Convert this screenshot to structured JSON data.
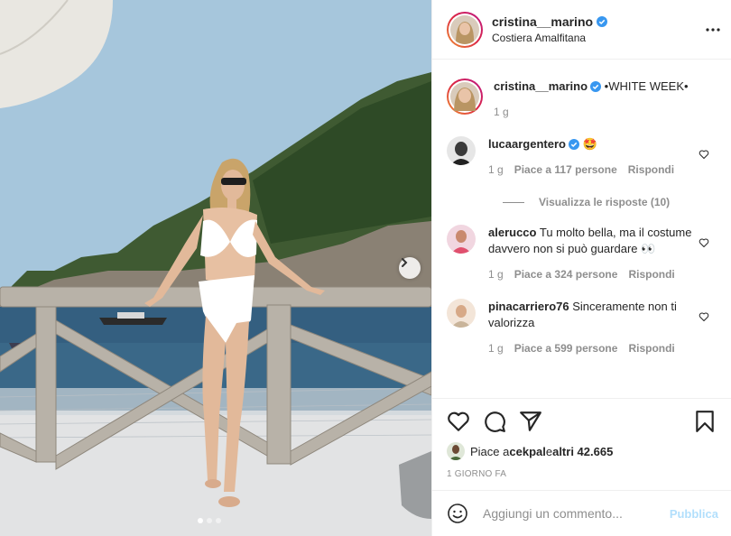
{
  "post": {
    "username": "cristina__marino",
    "location": "Costiera Amalfitana",
    "more_icon": "more-horizontal-icon"
  },
  "caption": {
    "username": "cristina__marino",
    "text": "•WHITE WEEK•",
    "time": "1 g"
  },
  "comments": [
    {
      "username": "lucaargentero",
      "verified": true,
      "text": "🤩",
      "time": "1 g",
      "likes": "Piace a 117 persone",
      "reply": "Rispondi"
    },
    {
      "username": "alerucco",
      "verified": false,
      "text": "Tu molto bella, ma il costume davvero non si può guardare 👀",
      "time": "1 g",
      "likes": "Piace a 324 persone",
      "reply": "Rispondi"
    },
    {
      "username": "pinacarriero76",
      "verified": false,
      "text": "Sinceramente non ti valorizza",
      "time": "1 g",
      "likes": "Piace a 599 persone",
      "reply": "Rispondi"
    }
  ],
  "view_replies": "Visualizza le risposte (10)",
  "actions": {
    "icons": [
      "heart-icon",
      "comment-icon",
      "share-icon",
      "bookmark-icon"
    ]
  },
  "likes": {
    "prefix": "Piace a ",
    "user": "cekpal",
    "middle": " e ",
    "others": "altri 42.665"
  },
  "date": "1 giorno fa",
  "add_comment": {
    "placeholder": "Aggiungi un commento...",
    "publish": "Pubblica"
  },
  "carousel": {
    "slides": 3,
    "active": 1
  },
  "colors": {
    "accent": "#0095f6",
    "publish_disabled": "#b2dffc",
    "muted": "#8e8e8e",
    "verified": "#3897f0"
  }
}
